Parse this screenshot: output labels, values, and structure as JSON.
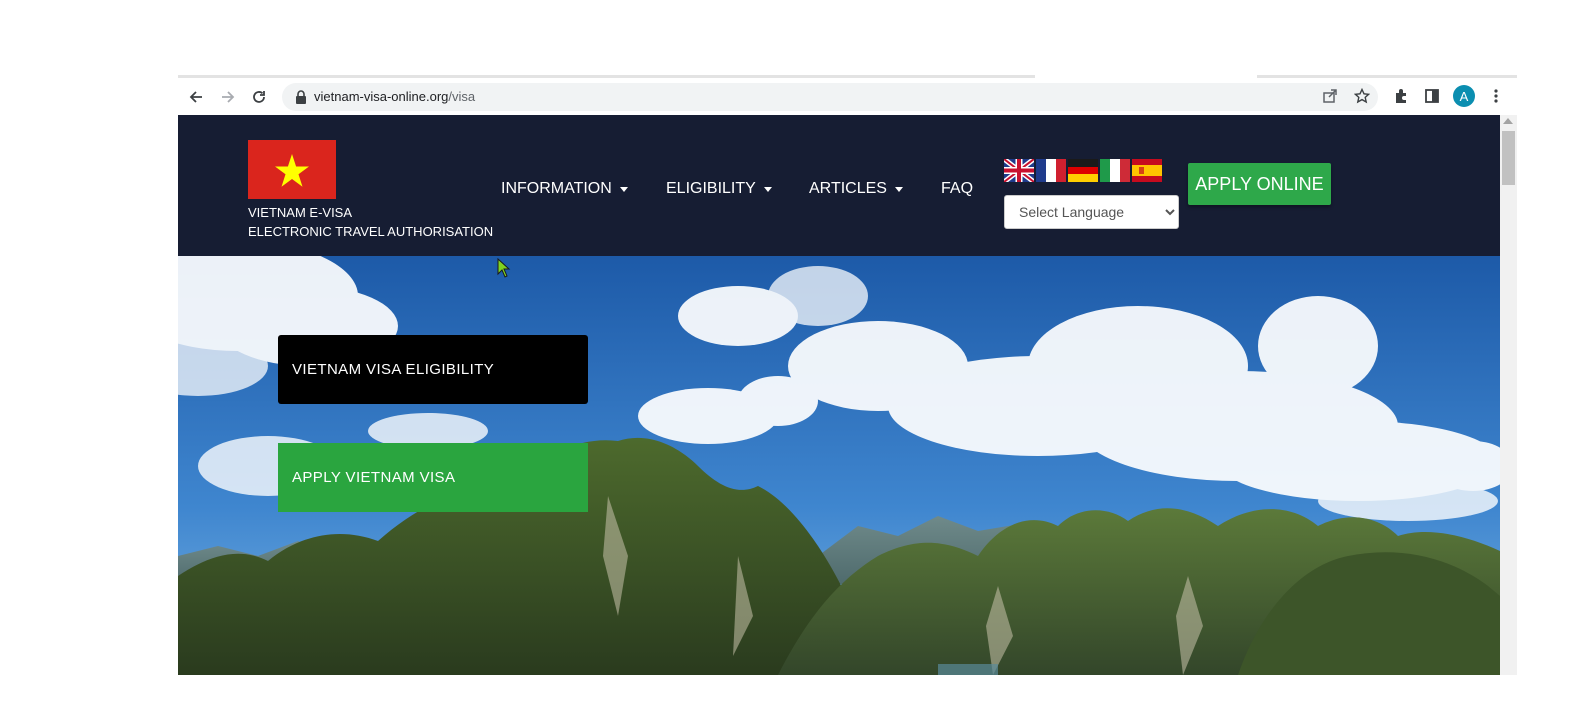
{
  "browser": {
    "url_domain": "vietnam-visa-online.org",
    "url_path": "/visa",
    "profile_initial": "A",
    "icons": [
      "back-arrow-icon",
      "forward-arrow-icon",
      "reload-icon",
      "lock-icon",
      "share-icon",
      "star-icon",
      "extensions-icon",
      "side-panel-icon",
      "menu-dots-icon"
    ]
  },
  "header": {
    "brand_line1": "VIETNAM E-VISA",
    "brand_line2": "ELECTRONIC TRAVEL AUTHORISATION",
    "nav": {
      "information": "INFORMATION",
      "eligibility": "ELIGIBILITY",
      "articles": "ARTICLES",
      "faq": "FAQ"
    },
    "language_flags": [
      "United Kingdom",
      "France",
      "Germany",
      "Italy",
      "Spain"
    ],
    "language_select": "Select Language",
    "apply_online": "APPLY ONLINE"
  },
  "hero": {
    "eligibility_button": "VIETNAM VISA ELIGIBILITY",
    "apply_button": "APPLY VIETNAM VISA"
  },
  "colors": {
    "header_bg": "#161d33",
    "apply_green": "#2ea84a",
    "vn_red": "#da251d",
    "vn_star": "#ffff00"
  }
}
